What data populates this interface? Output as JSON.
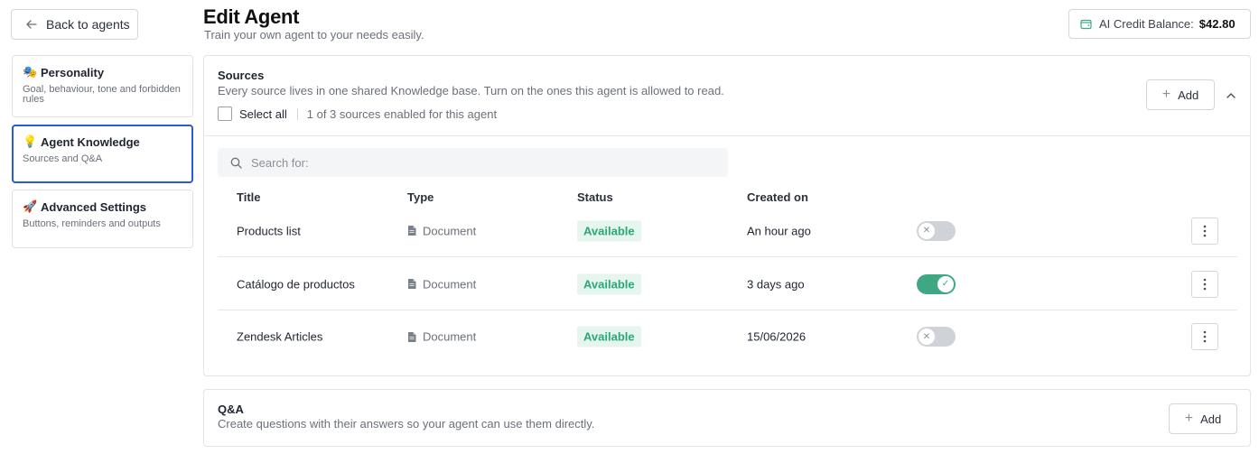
{
  "back_button": {
    "label": "Back to agents"
  },
  "nav": [
    {
      "emoji": "🎭",
      "title": "Personality",
      "subtitle": "Goal, behaviour, tone and forbidden rules"
    },
    {
      "emoji": "💡",
      "title": "Agent Knowledge",
      "subtitle": "Sources and Q&A"
    },
    {
      "emoji": "🚀",
      "title": "Advanced Settings",
      "subtitle": "Buttons, reminders and outputs"
    }
  ],
  "header": {
    "title": "Edit Agent",
    "subtitle": "Train your own agent to your needs easily."
  },
  "credit": {
    "label": "AI Credit Balance:",
    "amount": "$42.80"
  },
  "sources": {
    "title": "Sources",
    "description": "Every source lives in one shared Knowledge base. Turn on the ones this agent is allowed to read.",
    "select_all_label": "Select all",
    "enabled_count": "1 of 3 sources enabled for this agent",
    "add_label": "Add",
    "search_placeholder": "Search for:",
    "columns": [
      "Title",
      "Type",
      "Status",
      "Created on"
    ],
    "rows": [
      {
        "title": "Products list",
        "type": "Document",
        "status": "Available",
        "created": "An hour ago",
        "enabled": false
      },
      {
        "title": "Catálogo de productos",
        "type": "Document",
        "status": "Available",
        "created": "3 days ago",
        "enabled": true
      },
      {
        "title": "Zendesk Articles",
        "type": "Document",
        "status": "Available",
        "created": "15/06/2026",
        "enabled": false
      }
    ]
  },
  "qa": {
    "title": "Q&A",
    "description": "Create questions with their answers so your agent can use them directly.",
    "add_label": "Add"
  },
  "colors": {
    "accent_blue": "#2a5bd7",
    "success_green": "#3fa883",
    "badge_text": "#2aa877"
  },
  "icons": {
    "back": "arrow-left-icon",
    "wallet": "wallet-icon",
    "search": "search-icon",
    "document": "document-icon",
    "more": "more-vertical-icon",
    "collapse": "chevron-up-icon"
  }
}
